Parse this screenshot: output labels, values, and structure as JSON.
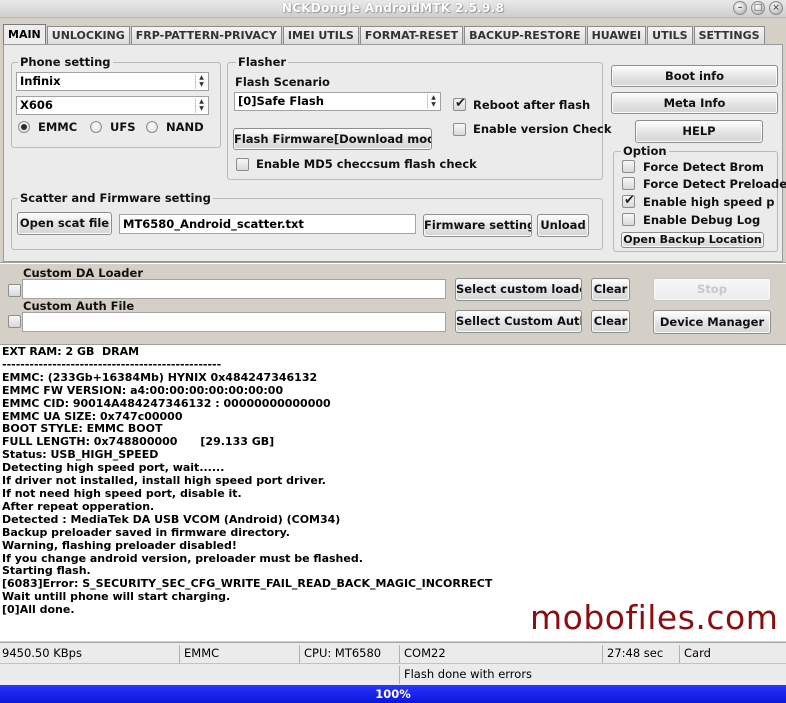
{
  "window": {
    "title": "NCKDongle AndroidMTK 2.5.9.8"
  },
  "tabs": [
    "MAIN",
    "UNLOCKING",
    "FRP-PATTERN-PRIVACY",
    "IMEI UTILS",
    "FORMAT-RESET",
    "BACKUP-RESTORE",
    "HUAWEI",
    "UTILS",
    "SETTINGS"
  ],
  "phone_setting": {
    "title": "Phone setting",
    "brand": "Infinix",
    "model": "X606",
    "storage_options": [
      "EMMC",
      "UFS",
      "NAND"
    ],
    "storage_selected": "EMMC"
  },
  "flasher": {
    "title": "Flasher",
    "scenario_label": "Flash Scenario",
    "scenario_value": "[0]Safe Flash",
    "reboot_label": "Reboot after flash",
    "reboot_checked": true,
    "version_check_label": "Enable version Check",
    "version_check_checked": false,
    "flash_button": "Flash Firmware[Download mode]",
    "md5_label": "Enable MD5 checcsum flash check",
    "md5_checked": false
  },
  "scatter": {
    "title": "Scatter and Firmware setting",
    "open_button": "Open scat file",
    "file": "MT6580_Android_scatter.txt",
    "firmware_button": "Firmware setting",
    "unload_button": "Unload"
  },
  "right_panel": {
    "boot_info": "Boot info",
    "meta_info": "Meta Info",
    "help": "HELP",
    "option_title": "Option",
    "options": [
      {
        "label": "Force Detect Brom",
        "checked": false
      },
      {
        "label": "Force Detect Preloader",
        "checked": false
      },
      {
        "label": "Enable high speed port",
        "checked": true
      },
      {
        "label": "Enable Debug Log",
        "checked": false
      }
    ],
    "open_backup": "Open Backup Location"
  },
  "loaders": {
    "da_label": "Custom DA Loader",
    "da_value": "",
    "select_da": "Select custom loader",
    "clear": "Clear",
    "auth_label": "Custom Auth File",
    "auth_value": "",
    "select_auth": "Sellect Custom Auth",
    "stop": "Stop",
    "device_manager": "Device Manager"
  },
  "log": [
    "EXT RAM: 2 GB  DRAM",
    "------------------------------------------------",
    "EMMC: (233Gb+16384Mb) HYNIX 0x484247346132",
    "EMMC FW VERSION: a4:00:00:00:00:00:00:00",
    "EMMC CID: 90014A484247346132 : 00000000000000",
    "EMMC UA SIZE: 0x747c00000",
    "BOOT STYLE: EMMC BOOT",
    "FULL LENGTH: 0x748800000      [29.133 GB]",
    "Status: USB_HIGH_SPEED",
    "Detecting high speed port, wait......",
    "If driver not installed, install high speed port driver.",
    "If not need high speed port, disable it.",
    "After repeat opperation.",
    "Detected : MediaTek DA USB VCOM (Android) (COM34)",
    "Backup preloader saved in firmware directory.",
    "Warning, flashing preloader disabled!",
    "If you change android version, preloader must be flashed.",
    "Starting flash.",
    "[6083]Error: S_SECURITY_SEC_CFG_WRITE_FAIL_READ_BACK_MAGIC_INCORRECT",
    "Wait untill phone will start charging.",
    "[0]All done."
  ],
  "watermark": "mobofiles.com",
  "status": {
    "speed": "9450.50 KBps",
    "storage": "EMMC",
    "cpu": "CPU: MT6580",
    "port": "COM22",
    "time": "27:48 sec",
    "card": "Card",
    "message": "Flash done with errors"
  },
  "progress": {
    "value": 100,
    "label": "100%"
  }
}
